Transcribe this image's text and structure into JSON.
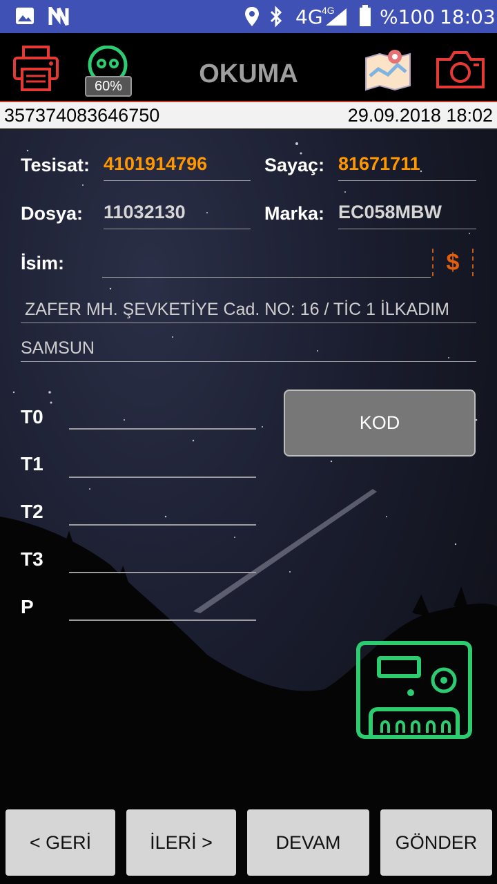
{
  "status_bar": {
    "network": "4G",
    "network_sup": "4G",
    "battery": "%100",
    "time": "18:03",
    "icons": [
      "image-icon",
      "n-icon",
      "location-icon",
      "bluetooth-icon",
      "signal-icon",
      "battery-icon"
    ]
  },
  "app_bar": {
    "title": "OKUMA",
    "battery_badge": "60%",
    "icons": [
      "printer-icon",
      "meter-reader-icon",
      "map-icon",
      "camera-icon"
    ]
  },
  "info_bar": {
    "device_id": "357374083646750",
    "datetime": "29.09.2018 18:02"
  },
  "form": {
    "tesisat_label": "Tesisat:",
    "tesisat_value": "4101914796",
    "sayac_label": "Sayaç:",
    "sayac_value": "81671711",
    "dosya_label": "Dosya:",
    "dosya_value": "11032130",
    "marka_label": "Marka:",
    "marka_value": "EC058MBW",
    "isim_label": "İsim:",
    "isim_value": "",
    "dollar_symbol": "$",
    "address_line1": "ZAFER MH. ŞEVKETİYE Cad. NO: 16 / TİC 1 İLKADIM",
    "address_line2": "SAMSUN"
  },
  "readings": {
    "t0_label": "T0",
    "t1_label": "T1",
    "t2_label": "T2",
    "t3_label": "T3",
    "p_label": "P",
    "kod_button": "KOD"
  },
  "buttons": {
    "back": "< GERİ",
    "next": "İLERİ >",
    "continue": "DEVAM",
    "send": "GÖNDER"
  },
  "colors": {
    "status_bar": "#3f51b5",
    "accent_orange": "#ff9800",
    "icon_red": "#e53935",
    "icon_green": "#2ecc71"
  }
}
